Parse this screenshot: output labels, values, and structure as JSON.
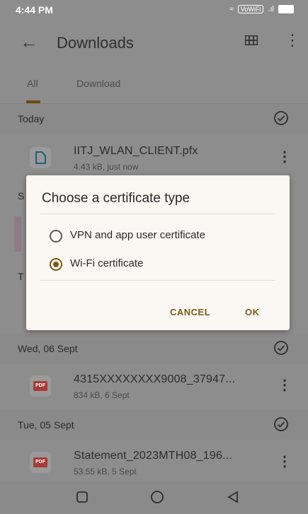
{
  "status": {
    "time": "4:44 PM",
    "vowifi": "VoWiFi"
  },
  "appbar": {
    "title": "Downloads"
  },
  "tabs": [
    {
      "label": "All"
    },
    {
      "label": "Download"
    }
  ],
  "sections": [
    {
      "label": "Today"
    },
    {
      "label": "S"
    },
    {
      "label": "T"
    },
    {
      "label": "Wed, 06 Sept"
    },
    {
      "label": "Tue, 05 Sept"
    }
  ],
  "files": [
    {
      "name": "IITJ_WLAN_CLIENT.pfx",
      "meta": "4.43 kB, just now"
    },
    {
      "name": "4315XXXXXXXX9008_37947...",
      "meta": "834 kB, 6 Sept",
      "badge": "PDF"
    },
    {
      "name": "Statement_2023MTH08_196...",
      "meta": "53.55 kB, 5 Sept",
      "badge": "PDF"
    }
  ],
  "dialog": {
    "title": "Choose a certificate type",
    "options": [
      {
        "label": "VPN and app user certificate",
        "selected": false
      },
      {
        "label": "Wi-Fi certificate",
        "selected": true
      }
    ],
    "cancel": "CANCEL",
    "ok": "OK"
  },
  "colors": {
    "accent": "#7a5a1a",
    "scrim": "#8d8d8d",
    "dialog_bg": "#fbf7f2"
  }
}
